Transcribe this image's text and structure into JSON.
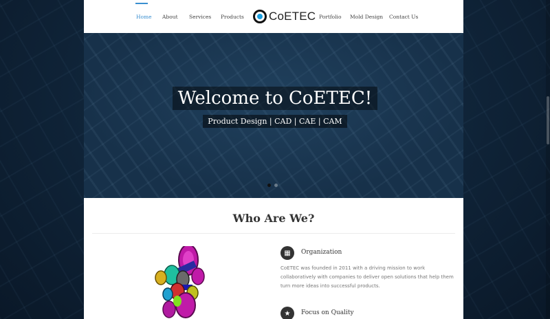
{
  "nav": {
    "left": [
      {
        "label": "Home",
        "active": true
      },
      {
        "label": "About"
      },
      {
        "label": "Services"
      },
      {
        "label": "Products"
      }
    ],
    "right": [
      {
        "label": "Portfolio"
      },
      {
        "label": "Mold Design"
      },
      {
        "label": "Contact Us"
      }
    ]
  },
  "logo": {
    "text": "CoETEC",
    "icon": "coetec-logo-icon"
  },
  "hero": {
    "title": "Welcome to CoETEC!",
    "subtitle": "Product Design | CAD | CAE | CAM",
    "slides": 2,
    "active_slide": 1
  },
  "section": {
    "title": "Who Are We?",
    "features": [
      {
        "icon": "building-icon",
        "title": "Organization",
        "text": "CoETEC was founded in 2011 with a driving mission to work collaboratively with companies to deliver open solutions that help them turn more ideas into successful products."
      },
      {
        "icon": "star-icon",
        "title": "Focus on Quality",
        "text": ""
      }
    ]
  },
  "colors": {
    "accent": "#3a8fd0",
    "logo_blue": "#1a9fe0"
  }
}
